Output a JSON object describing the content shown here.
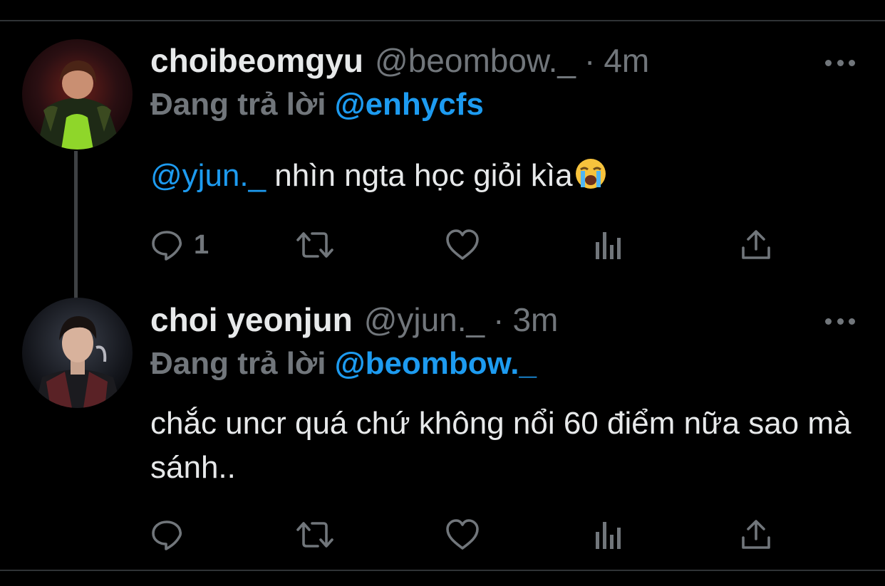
{
  "tweets": [
    {
      "display_name": "choibeomgyu",
      "handle": "@beombow._",
      "separator": "·",
      "time": "4m",
      "reply_prefix": "Đang trả lời",
      "reply_to": "@enhycfs",
      "text_mention": "@yjun._",
      "text": " nhìn ngta học giỏi kìa",
      "emoji": "loudly-crying-face",
      "reply_count": "1"
    },
    {
      "display_name": "choi yeonjun",
      "handle": "@yjun._",
      "separator": "·",
      "time": "3m",
      "reply_prefix": "Đang trả lời",
      "reply_to": "@beombow._",
      "text": "chắc uncr quá chứ không nổi 60 điểm nữa sao mà sánh.."
    }
  ],
  "icons": {
    "reply": "reply-icon",
    "retweet": "retweet-icon",
    "like": "like-icon",
    "stats": "stats-icon",
    "share": "share-icon",
    "more": "more-icon"
  },
  "colors": {
    "background": "#000000",
    "text": "#e7e9ea",
    "muted": "#71767b",
    "accent": "#1d9bf0",
    "divider": "#2f3336"
  }
}
